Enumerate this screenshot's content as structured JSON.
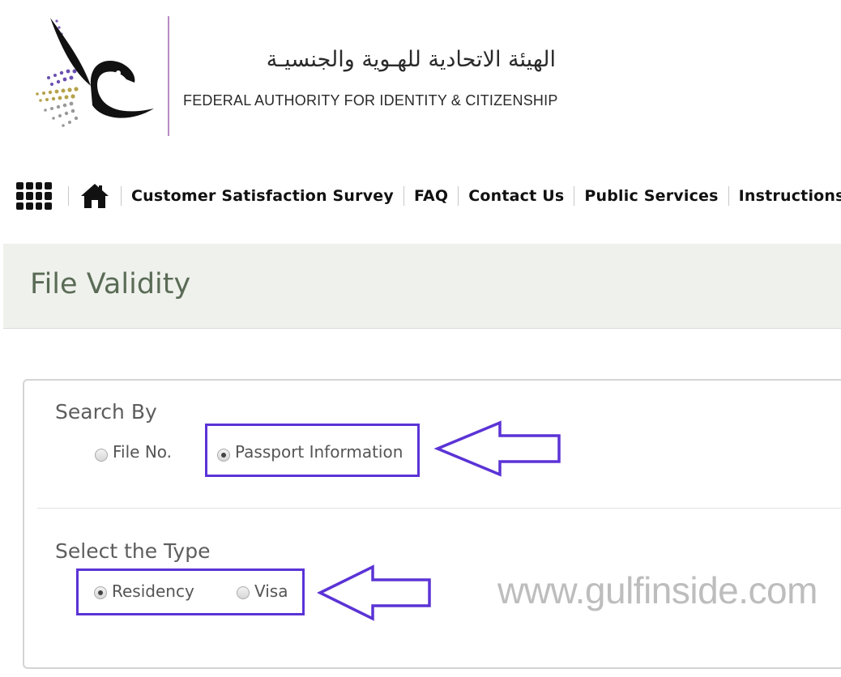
{
  "header": {
    "org_name_arabic": "الهيئة الاتحادية للهـوية والجنسيـة",
    "org_name_english": "FEDERAL AUTHORITY FOR IDENTITY & CITIZENSHIP"
  },
  "nav": {
    "items": [
      {
        "label": "Customer Satisfaction Survey"
      },
      {
        "label": "FAQ"
      },
      {
        "label": "Contact Us"
      },
      {
        "label": "Public Services"
      },
      {
        "label": "Instructions"
      }
    ]
  },
  "page": {
    "title": "File Validity"
  },
  "form": {
    "search_by": {
      "label": "Search By",
      "options": [
        {
          "label": "File No.",
          "checked": false
        },
        {
          "label": "Passport Information",
          "checked": true
        }
      ]
    },
    "select_type": {
      "label": "Select the Type",
      "options": [
        {
          "label": "Residency",
          "checked": true
        },
        {
          "label": "Visa",
          "checked": false
        }
      ]
    }
  },
  "annotation": {
    "color": "#5b33d6"
  },
  "watermark": {
    "text": "www.gulfinside.com"
  },
  "icons": [
    "logo-falcon-icon",
    "apps-grid-icon",
    "home-icon",
    "arrow-left-icon"
  ]
}
